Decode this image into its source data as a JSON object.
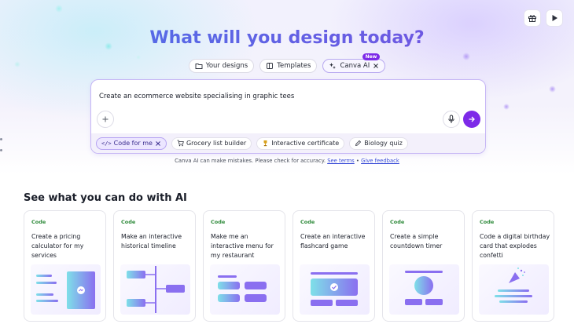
{
  "hero": {
    "headline": "What will you design today?"
  },
  "top_actions": [
    {
      "icon": "gift-icon"
    },
    {
      "icon": "play-icon"
    }
  ],
  "tabs": [
    {
      "label": "Your designs",
      "icon": "folder-icon"
    },
    {
      "label": "Templates",
      "icon": "template-icon"
    },
    {
      "label": "Canva AI",
      "icon": "sparkle-icon",
      "badge": "New",
      "active": true
    }
  ],
  "prompt": {
    "text": "Create an ecommerce website specialising in graphic tees"
  },
  "suggestions": [
    {
      "label": "Code for me",
      "icon": "code-icon",
      "active": true
    },
    {
      "label": "Grocery list builder",
      "icon": "cart-icon"
    },
    {
      "label": "Interactive certificate",
      "icon": "trophy-icon"
    },
    {
      "label": "Biology quiz",
      "icon": "pencil-icon"
    }
  ],
  "disclaimer": {
    "text": "Canva AI can make mistakes. Please check for accuracy.",
    "terms_link": "See terms",
    "separator": "•",
    "feedback_link": "Give feedback"
  },
  "section": {
    "title": "See what you can do with AI"
  },
  "cards": [
    {
      "tag": "Code",
      "text": "Create a pricing calculator for my services"
    },
    {
      "tag": "Code",
      "text": "Make an interactive historical timeline"
    },
    {
      "tag": "Code",
      "text": "Make me an interactive menu for my restaurant"
    },
    {
      "tag": "Code",
      "text": "Create an interactive flashcard game"
    },
    {
      "tag": "Code",
      "text": "Create a simple countdown timer"
    },
    {
      "tag": "Code",
      "text": "Code a digital birthday card that explodes confetti"
    }
  ],
  "colors": {
    "accent": "#7d2ae8",
    "headline_start": "#4a73e8",
    "headline_end": "#7a4fe0",
    "tag_green": "#2e8a3a",
    "link_blue": "#3d4fd8"
  }
}
